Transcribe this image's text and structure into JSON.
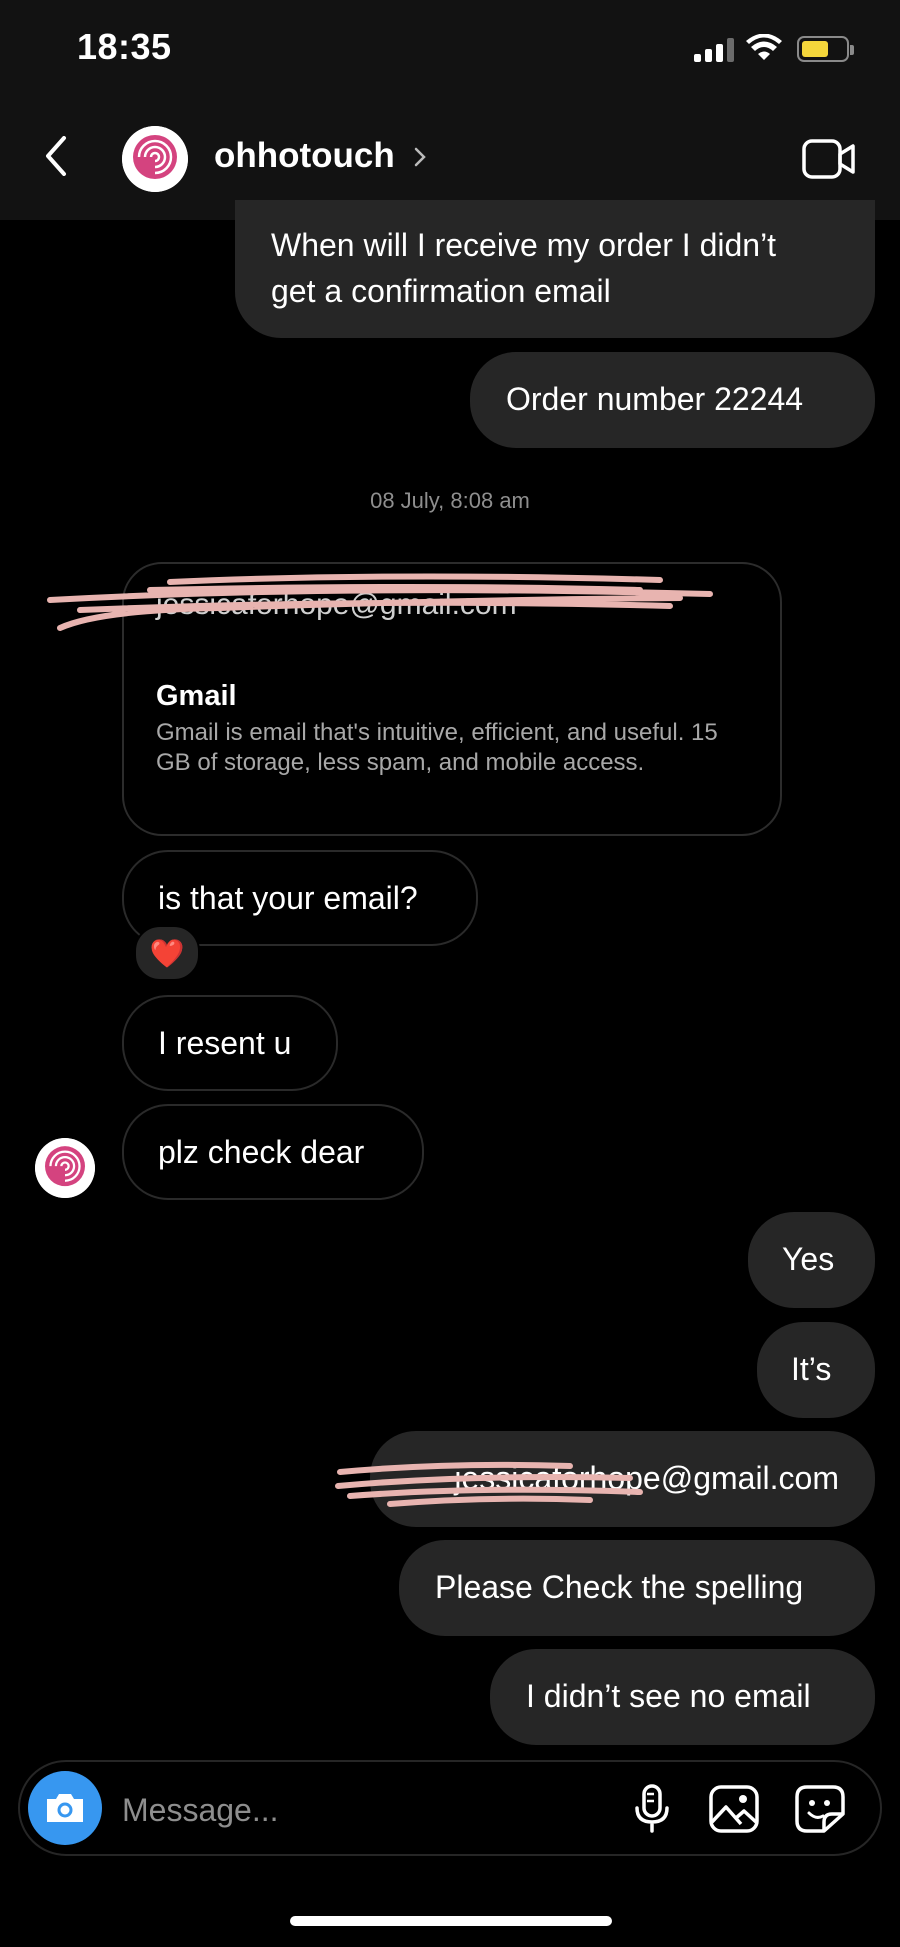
{
  "status_bar": {
    "time": "18:35"
  },
  "header": {
    "username": "ohhotouch",
    "avatar_text": "OHHOTOUCH"
  },
  "messages": {
    "order_question": "When will I receive my order I didn’t get a confirmation email",
    "order_question_line1": "When will I receive my order I didn’t",
    "order_question_line2": "get a confirmation email",
    "order_number": "Order number 22244",
    "timestamp": "08 July, 8:08 am",
    "link_card": {
      "email": "jessicaforhope@gmail.com",
      "title": "Gmail",
      "description": "Gmail is email that's intuitive, efficient, and useful. 15 GB of storage, less spam, and mobile access."
    },
    "is_that_email": "is that your email?",
    "reaction": "❤️",
    "resent": "I resent u",
    "check": "plz check dear",
    "yes": "Yes",
    "its": "It’s",
    "email_reply": "jessicaforhope@gmail.com",
    "check_spelling": "Please Check the spelling",
    "no_email": "I didn’t see no email"
  },
  "composer": {
    "placeholder": "Message..."
  },
  "colors": {
    "accent": "#3797f0",
    "sent_bubble": "#262626",
    "scribble": "#e8b4b0",
    "avatar_pink": "#d4437f"
  }
}
